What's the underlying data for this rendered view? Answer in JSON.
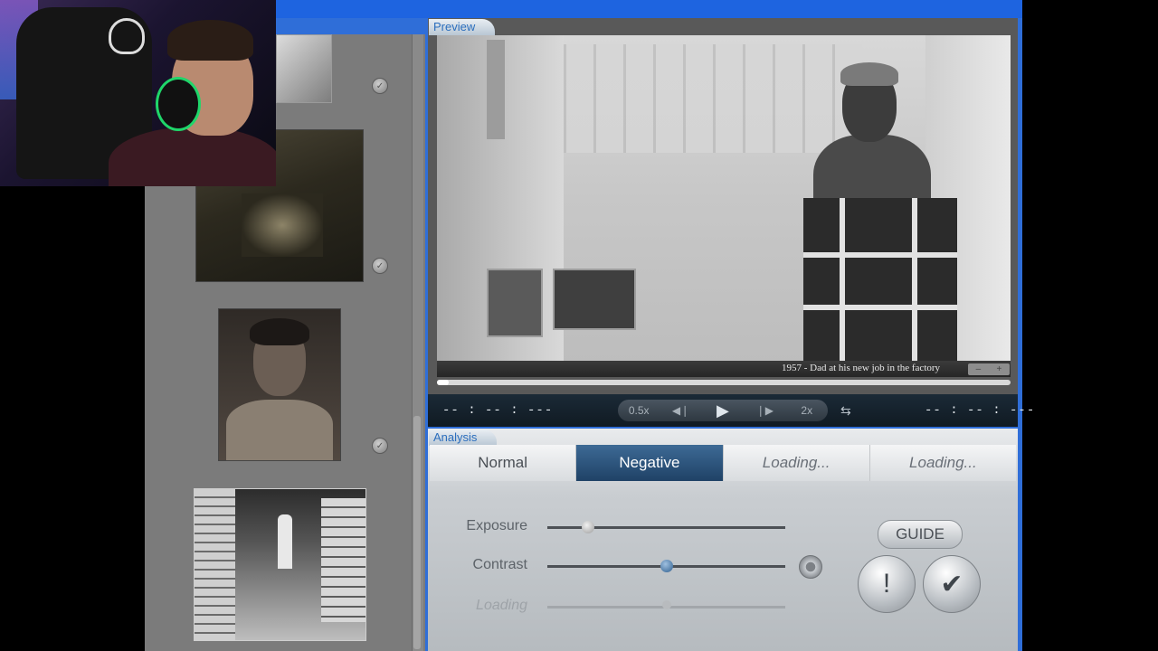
{
  "preview": {
    "tab_label": "Preview",
    "caption": "1957 - Dad at his new job in the factory",
    "zoom_minus": "–",
    "zoom_plus": "+",
    "progress": 0.02
  },
  "transport": {
    "time_left": "-- : -- : ---",
    "time_right": "-- : -- : ---",
    "speed_slow": "0.5x",
    "prev_icon": "◀❘",
    "play_icon": "▶",
    "next_icon": "❘▶",
    "speed_fast": "2x",
    "loop_icon": "⇆"
  },
  "analysis": {
    "tab_label": "Analysis",
    "tabs": [
      {
        "label": "Normal"
      },
      {
        "label": "Negative"
      },
      {
        "label": "Loading..."
      },
      {
        "label": "Loading..."
      }
    ],
    "sliders": [
      {
        "label": "Exposure",
        "value": 0.17
      },
      {
        "label": "Contrast",
        "value": 0.5
      },
      {
        "label": "Loading",
        "value": 0.5
      }
    ],
    "guide_label": "GUIDE",
    "alert_label": "!",
    "confirm_label": "✔"
  },
  "thumbnails": {
    "check_icon": "✓"
  },
  "colors": {
    "active_tab": "#1f4266",
    "window_blue": "#1e64e0",
    "transport_bg": "#101a22"
  }
}
